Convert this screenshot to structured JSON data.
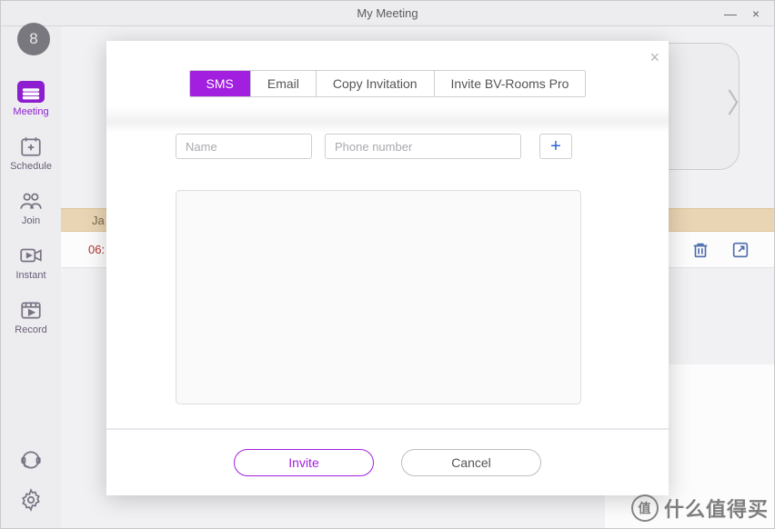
{
  "window": {
    "title": "My Meeting",
    "minimize": "—",
    "close": "×"
  },
  "avatar": {
    "text": "8"
  },
  "nav": {
    "items": [
      {
        "label": "Meeting"
      },
      {
        "label": "Schedule"
      },
      {
        "label": "Join"
      },
      {
        "label": "Instant"
      },
      {
        "label": "Record"
      }
    ]
  },
  "background": {
    "date_label": "Ja",
    "event_time": "06:"
  },
  "modal": {
    "tabs": [
      {
        "label": "SMS",
        "selected": true
      },
      {
        "label": "Email"
      },
      {
        "label": "Copy Invitation"
      },
      {
        "label": "Invite BV-Rooms Pro"
      }
    ],
    "name_placeholder": "Name",
    "phone_placeholder": "Phone number",
    "add_symbol": "+",
    "invite_label": "Invite",
    "cancel_label": "Cancel",
    "close_symbol": "×"
  },
  "watermark": {
    "circle": "值",
    "text": "什么值得买"
  }
}
